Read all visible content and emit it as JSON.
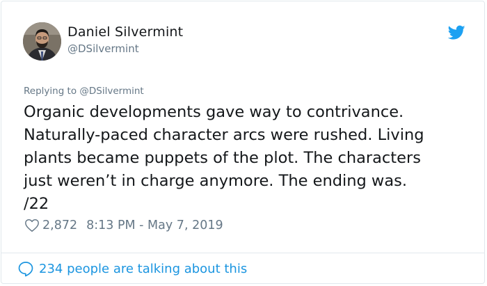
{
  "author": {
    "name": "Daniel Silvermint",
    "handle": "@DSilvermint"
  },
  "replying_to": "Replying to @DSilvermint",
  "tweet_text": "Organic developments gave way to contrivance.\nNaturally-paced character arcs were rushed. Living\nplants became puppets of the plot. The characters\njust weren’t in charge anymore. The ending was.\n/22",
  "likes": "2,872",
  "timestamp": "8:13 PM - May 7, 2019",
  "talking_about": "234 people are talking about this",
  "colors": {
    "brand": "#1da1f2",
    "link": "#1b95e0",
    "muted": "#657786",
    "text": "#14171a",
    "border": "#e1e8ed"
  },
  "icons": {
    "platform": "twitter-bird-icon",
    "like": "heart-outline-icon",
    "replies": "speech-bubble-icon"
  }
}
